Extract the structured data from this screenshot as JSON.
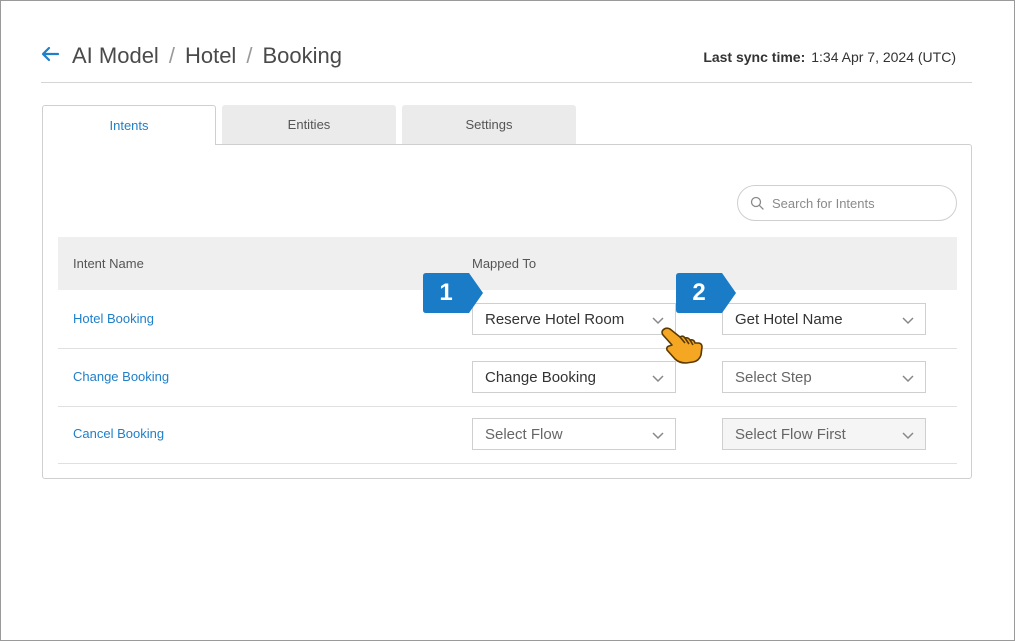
{
  "header": {
    "breadcrumb": [
      "AI Model",
      "Hotel",
      "Booking"
    ],
    "separator": "/",
    "sync_label": "Last sync time:",
    "sync_value": "1:34 Apr 7, 2024 (UTC)"
  },
  "tabs": [
    {
      "label": "Intents",
      "active": true
    },
    {
      "label": "Entities",
      "active": false
    },
    {
      "label": "Settings",
      "active": false
    }
  ],
  "search": {
    "placeholder": "Search for Intents",
    "value": ""
  },
  "table": {
    "columns": [
      "Intent Name",
      "Mapped To"
    ],
    "rows": [
      {
        "intent": "Hotel Booking",
        "flow": "Reserve Hotel Room",
        "step": "Get Hotel Name"
      },
      {
        "intent": "Change Booking",
        "flow": "Change Booking",
        "step": "Select Step"
      },
      {
        "intent": "Cancel Booking",
        "flow": "Select Flow",
        "step": "Select Flow First"
      }
    ]
  },
  "callouts": [
    "1",
    "2"
  ],
  "colors": {
    "accent": "#1f7fc9",
    "callout": "#1a7bc6",
    "hand": "#f5a623"
  },
  "icons": [
    "back-arrow-icon",
    "search-icon",
    "chevron-down-icon",
    "pointing-hand-icon"
  ]
}
